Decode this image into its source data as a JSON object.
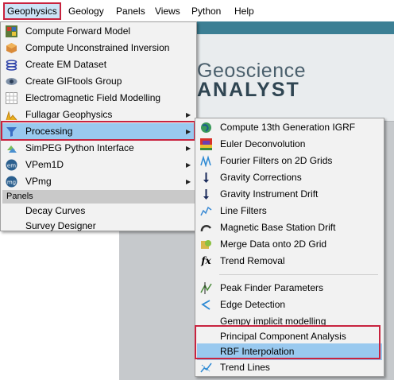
{
  "menubar": {
    "items": [
      "Geophysics",
      "Geology",
      "Panels",
      "Views",
      "Python",
      "Help"
    ]
  },
  "background": {
    "logo_line1": "Geoscience",
    "logo_line2": "ANALYST"
  },
  "geophysics_menu": {
    "items": [
      {
        "label": "Compute Forward Model",
        "icon": "forward-model-icon"
      },
      {
        "label": "Compute Unconstrained Inversion",
        "icon": "inversion-icon"
      },
      {
        "label": "Create EM Dataset",
        "icon": "em-dataset-icon"
      },
      {
        "label": "Create GIFtools Group",
        "icon": "giftools-icon"
      },
      {
        "label": "Electromagnetic Field Modelling",
        "icon": "grid-icon"
      },
      {
        "label": "Fullagar Geophysics",
        "icon": "fullagar-icon"
      },
      {
        "label": "Processing",
        "icon": "funnel-icon"
      },
      {
        "label": "SimPEG Python Interface",
        "icon": "simpeg-icon"
      },
      {
        "label": "VPem1D",
        "icon": "em-badge-icon",
        "badge": "em"
      },
      {
        "label": "VPmg",
        "icon": "mg-badge-icon",
        "badge": "mg"
      }
    ],
    "section_label": "Panels",
    "panel_items": [
      "Decay Curves",
      "Survey Designer"
    ]
  },
  "processing_menu": {
    "items": [
      {
        "label": "Compute 13th Generation IGRF",
        "icon": "globe-icon"
      },
      {
        "label": "Euler Deconvolution",
        "icon": "heatmap-icon"
      },
      {
        "label": "Fourier Filters on 2D Grids",
        "icon": "wave-icon"
      },
      {
        "label": "Gravity Corrections",
        "icon": "gravity-arrow-icon"
      },
      {
        "label": "Gravity Instrument Drift",
        "icon": "gravity-arrow-icon"
      },
      {
        "label": "Line Filters",
        "icon": "line-filter-icon"
      },
      {
        "label": "Magnetic Base Station Drift",
        "icon": "magnet-icon"
      },
      {
        "label": "Merge Data onto 2D Grid",
        "icon": "merge-icon"
      },
      {
        "label": "Trend Removal",
        "icon": "fx-icon",
        "glyph": "fx"
      },
      {
        "label": "Peak Finder Parameters",
        "icon": "peak-icon"
      },
      {
        "label": "Edge Detection",
        "icon": "edge-icon"
      },
      {
        "label": "Gempy implicit modelling",
        "icon": ""
      },
      {
        "label": "Principal Component Analysis",
        "icon": ""
      },
      {
        "label": "RBF Interpolation",
        "icon": ""
      },
      {
        "label": "Trend Lines",
        "icon": "trend-lines-icon"
      }
    ]
  },
  "colors": {
    "highlight": "#99c9ef",
    "annotation": "#c8233f"
  }
}
